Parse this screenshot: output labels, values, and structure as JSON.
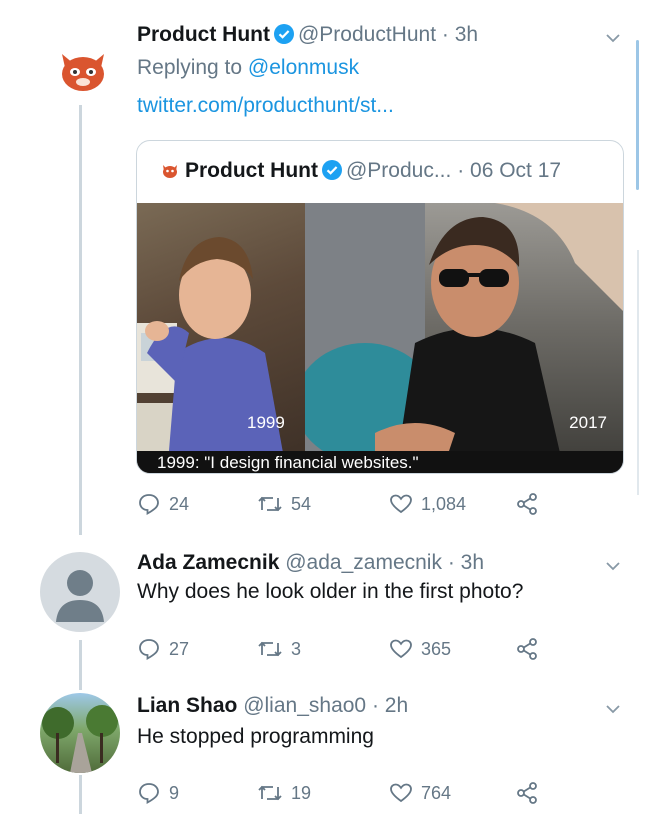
{
  "tweets": [
    {
      "name": "Product Hunt",
      "handle": "@ProductHunt",
      "time": "· 3h",
      "reply_prefix": "Replying to",
      "reply_to": "@elonmusk",
      "link": "twitter.com/producthunt/st...",
      "quote": {
        "name": "Product Hunt",
        "handle": "@Produc...",
        "time": "· 06 Oct 17",
        "year_left": "1999",
        "year_right": "2017",
        "caption": "1999: \"I design financial websites.\""
      },
      "replies": "24",
      "retweets": "54",
      "likes": "1,084"
    },
    {
      "name": "Ada Zamecnik",
      "handle": "@ada_zamecnik",
      "time": "· 3h",
      "text": "Why does he look older in the first photo?",
      "replies": "27",
      "retweets": "3",
      "likes": "365"
    },
    {
      "name": "Lian Shao",
      "handle": "@lian_shao0",
      "time": "· 2h",
      "text": "He stopped programming",
      "replies": "9",
      "retweets": "19",
      "likes": "764"
    }
  ],
  "colors": {
    "link": "#1b95e0",
    "muted": "#657786",
    "verified": "#1da1f2",
    "thread_line": "#ccd6dd"
  }
}
